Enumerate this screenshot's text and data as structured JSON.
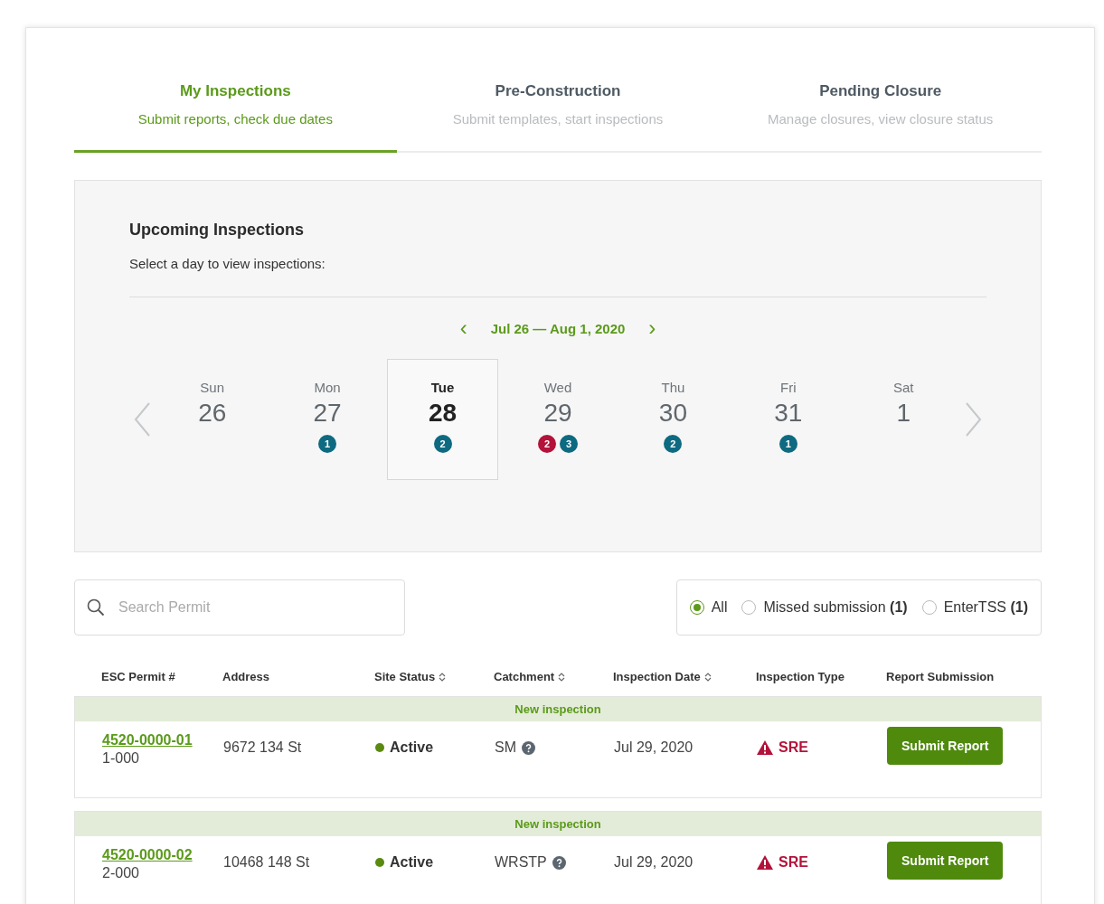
{
  "tabs": [
    {
      "title": "My Inspections",
      "subtitle": "Submit reports, check due dates",
      "selected": true
    },
    {
      "title": "Pre-Construction",
      "subtitle": "Submit templates, start inspections",
      "selected": false
    },
    {
      "title": "Pending Closure",
      "subtitle": "Manage closures, view closure status",
      "selected": false
    }
  ],
  "upcoming": {
    "title": "Upcoming Inspections",
    "hint": "Select a day to view inspections:",
    "week_prev": "‹",
    "week_label": "Jul 26 — Aug 1, 2020",
    "week_next": "›",
    "days": [
      {
        "name": "Sun",
        "date": "26",
        "selected": false
      },
      {
        "name": "Mon",
        "date": "27",
        "selected": false,
        "badges": [
          {
            "count": "1",
            "color": "#0e6a80"
          }
        ]
      },
      {
        "name": "Tue",
        "date": "28",
        "selected": true,
        "badges": [
          {
            "count": "2",
            "color": "#0e6a80"
          }
        ]
      },
      {
        "name": "Wed",
        "date": "29",
        "selected": false,
        "badges": [
          {
            "count": "2",
            "color": "#b3123a"
          },
          {
            "count": "3",
            "color": "#0e6a80"
          }
        ]
      },
      {
        "name": "Thu",
        "date": "30",
        "selected": false,
        "badges": [
          {
            "count": "2",
            "color": "#0e6a80"
          }
        ]
      },
      {
        "name": "Fri",
        "date": "31",
        "selected": false,
        "badges": [
          {
            "count": "1",
            "color": "#0e6a80"
          }
        ]
      },
      {
        "name": "Sat",
        "date": "1",
        "selected": false
      }
    ]
  },
  "search": {
    "placeholder": "Search Permit"
  },
  "filters": [
    {
      "label": "All",
      "selected": true
    },
    {
      "label": "Missed submission **(1)**",
      "selected": false
    },
    {
      "label": "EnterTSS **(1)**",
      "selected": false
    }
  ],
  "table": {
    "columns": [
      {
        "label": "ESC Permit #",
        "sortable": false
      },
      {
        "label": "Address",
        "sortable": false
      },
      {
        "label": "Site Status",
        "sortable": true
      },
      {
        "label": "Catchment",
        "sortable": true
      },
      {
        "label": "Inspection Date",
        "sortable": true
      },
      {
        "label": "Inspection Type",
        "sortable": false
      },
      {
        "label": "Report Submission",
        "sortable": false
      }
    ],
    "rows": [
      {
        "band": "New inspection",
        "permit": "4520-0000-01",
        "permit_sub": "1-000",
        "address": "9672 134 St",
        "status": "Active",
        "catchment": "SM",
        "date": "Jul 29, 2020",
        "type": "SRE",
        "action": "Submit Report"
      },
      {
        "band": "New inspection",
        "permit": "4520-0000-02",
        "permit_sub": "2-000",
        "address": "10468 148 St",
        "status": "Active",
        "catchment": "WRSTP",
        "date": "Jul 29, 2020",
        "type": "SRE",
        "action": "Submit Report"
      }
    ]
  }
}
